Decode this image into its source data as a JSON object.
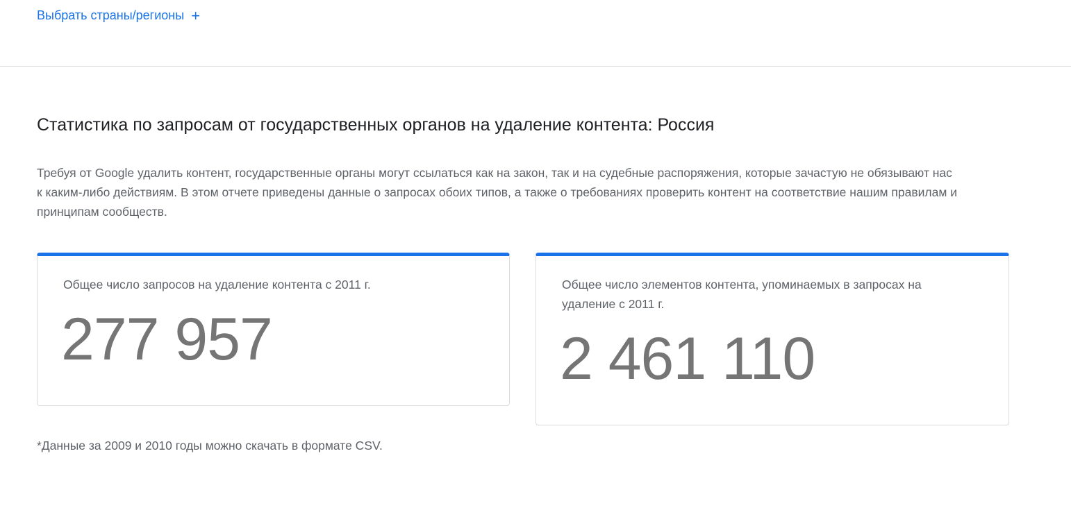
{
  "header": {
    "select_link_label": "Выбрать страны/регионы",
    "select_link_icon": "plus-icon",
    "select_link_glyph": "+"
  },
  "section": {
    "title": "Статистика по запросам от государственных органов на удаление контента: Россия",
    "description": "Требуя от Google удалить контент, государственные органы могут ссылаться как на закон, так и на судебные распоряжения, которые зачастую не обязывают нас к каким-либо действиям. В этом отчете приведены данные о запросах обоих типов, а также о требованиях проверить контент на соответствие нашим правилам и принципам сообществ."
  },
  "cards": [
    {
      "label": "Общее число запросов на удаление контента с 2011 г.",
      "value": "277 957"
    },
    {
      "label": "Общее число элементов контента, упоминаемых в запросах на удаление с 2011 г.",
      "value": "2 461 110"
    }
  ],
  "footnote": "*Данные за 2009 и 2010 годы можно скачать в формате CSV.",
  "colors": {
    "accent": "#1a73e8",
    "value_text": "#757575",
    "secondary_text": "#5f6368",
    "border": "#dadce0"
  }
}
